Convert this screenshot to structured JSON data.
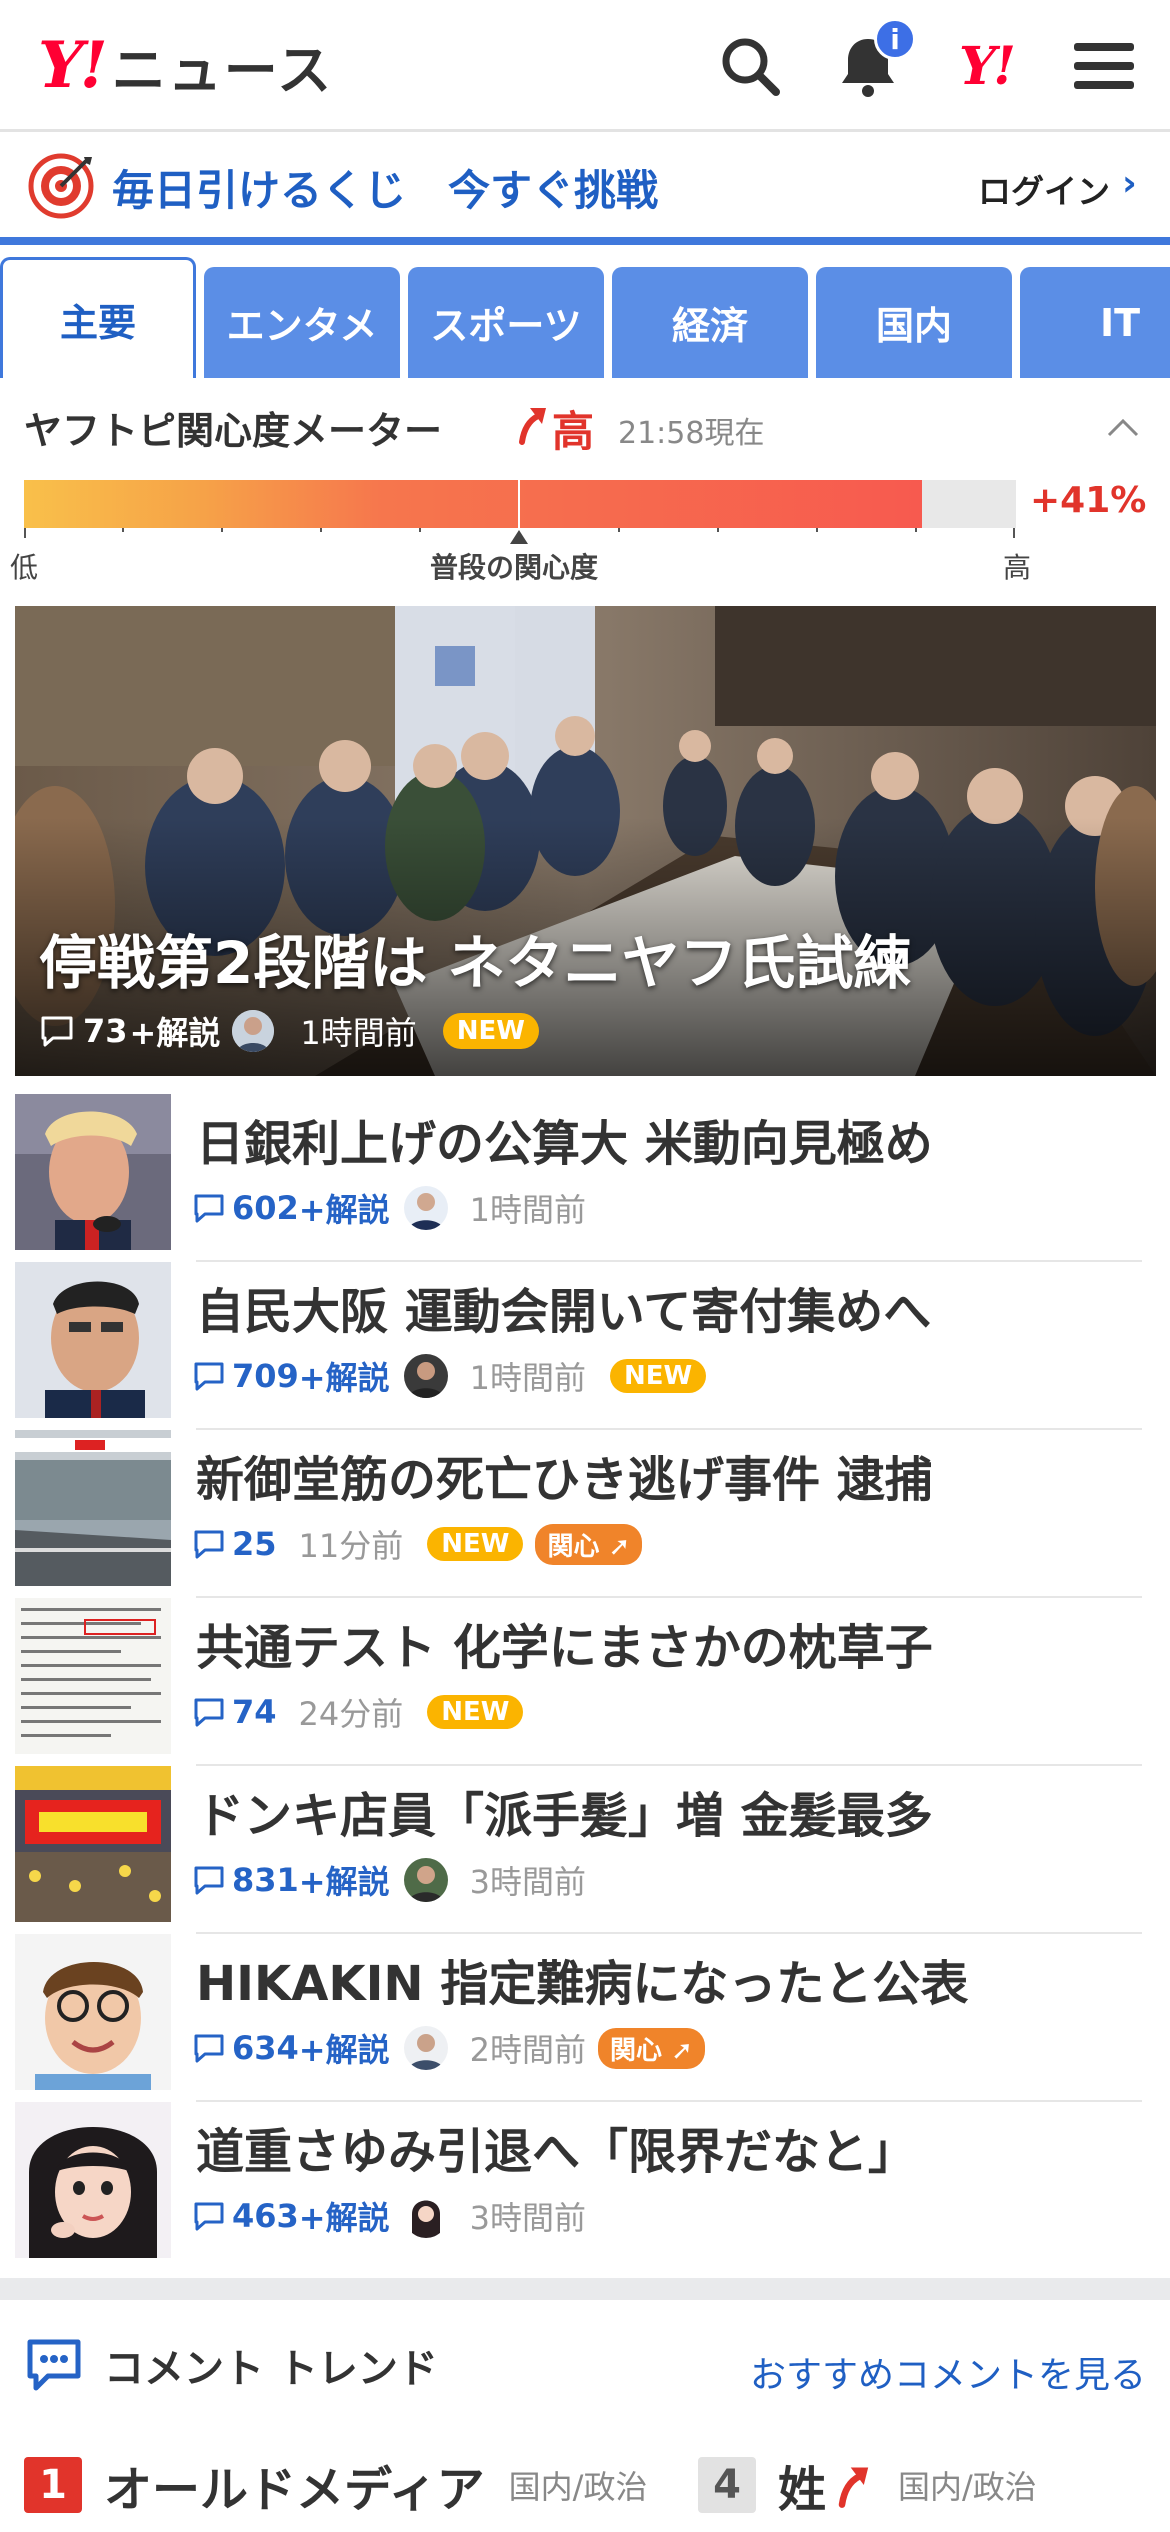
{
  "header": {
    "logo_mark": "Y!",
    "logo_text": "ニュース",
    "notif_badge": "i",
    "yahoo_icon": "Y!"
  },
  "promo": {
    "text1": "毎日引けるくじ",
    "text2": "今すぐ挑戦",
    "login": "ログイン",
    "login_arrow": "›"
  },
  "tabs": [
    "主要",
    "エンタメ",
    "スポーツ",
    "経済",
    "国内",
    "IT"
  ],
  "meter": {
    "title": "ヤフトピ関心度メーター",
    "level": "高",
    "time": "21:58現在",
    "percent": "+41%",
    "low_label": "低",
    "avg_label": "普段の関心度",
    "high_label": "高",
    "fill_fraction": 0.905
  },
  "hero": {
    "headline": "停戦第2段階は ネタニヤフ氏試練",
    "comment_count": "73",
    "kaisetsu": "+解説",
    "time": "1時間前",
    "new_badge": "NEW"
  },
  "articles": [
    {
      "title": "日銀利上げの公算大 米動向見極め",
      "count": "602",
      "kaisetsu": "+解説",
      "time": "1時間前",
      "new": "",
      "interest": ""
    },
    {
      "title": "自民大阪 運動会開いて寄付集めへ",
      "count": "709",
      "kaisetsu": "+解説",
      "time": "1時間前",
      "new": "NEW",
      "interest": ""
    },
    {
      "title": "新御堂筋の死亡ひき逃げ事件 逮捕",
      "count": "25",
      "kaisetsu": "",
      "time": "11分前",
      "new": "NEW",
      "interest": "関心"
    },
    {
      "title": "共通テスト 化学にまさかの枕草子",
      "count": "74",
      "kaisetsu": "",
      "time": "24分前",
      "new": "NEW",
      "interest": ""
    },
    {
      "title": "ドンキ店員「派手髪」増 金髪最多",
      "count": "831",
      "kaisetsu": "+解説",
      "time": "3時間前",
      "new": "",
      "interest": ""
    },
    {
      "title": "HIKAKIN 指定難病になったと公表",
      "count": "634",
      "kaisetsu": "+解説",
      "time": "2時間前",
      "new": "",
      "interest": "関心"
    },
    {
      "title": "道重さゆみ引退へ「限界だなと」",
      "count": "463",
      "kaisetsu": "+解説",
      "time": "3時間前",
      "new": "",
      "interest": ""
    }
  ],
  "comment_trend": {
    "title": "コメント トレンド",
    "link": "おすすめコメントを見る",
    "ranks": [
      {
        "num": "1",
        "word": "オールドメディア",
        "category": "国内/政治",
        "color": "#e1342b"
      },
      {
        "num": "4",
        "word": "姓",
        "category": "国内/政治",
        "color": "#dddddd"
      }
    ]
  },
  "colors": {
    "brand_red": "#ff0033",
    "link_blue": "#1f5fc3",
    "tab_blue": "#5b8ee6",
    "new_badge": "#fbb400",
    "interest_badge": "#f0842a"
  }
}
